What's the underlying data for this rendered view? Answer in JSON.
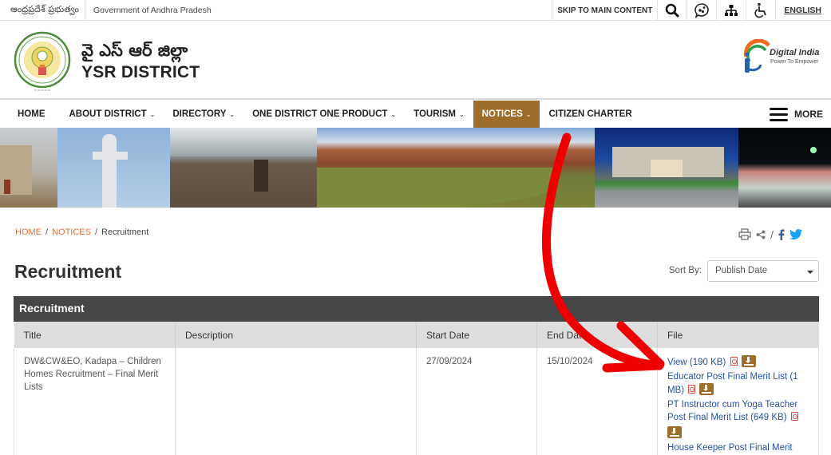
{
  "topbar": {
    "gov_telugu": "ఆంధ్రప్రదేశ్ ప్రభుత్వం",
    "gov_english": "Government of Andhra Pradesh",
    "skip_link": "SKIP TO MAIN CONTENT",
    "language": "ENGLISH",
    "icons": [
      "search-icon",
      "social-media-icon",
      "sitemap-icon",
      "accessibility-icon"
    ]
  },
  "header": {
    "title_telugu": "వై ఎస్ ఆర్ జిల్లా",
    "title_english": "YSR DISTRICT",
    "partner_logo": "Digital India",
    "partner_tagline": "Power To Empower"
  },
  "nav": {
    "items": [
      {
        "label": "HOME",
        "dropdown": false,
        "active": false
      },
      {
        "label": "ABOUT DISTRICT",
        "dropdown": true,
        "active": false
      },
      {
        "label": "DIRECTORY",
        "dropdown": true,
        "active": false
      },
      {
        "label": "ONE DISTRICT ONE PRODUCT",
        "dropdown": true,
        "active": false
      },
      {
        "label": "TOURISM",
        "dropdown": true,
        "active": false
      },
      {
        "label": "NOTICES",
        "dropdown": true,
        "active": true
      },
      {
        "label": "CITIZEN CHARTER",
        "dropdown": false,
        "active": false
      }
    ],
    "more_label": "MORE",
    "active_color": "#9e6d2b"
  },
  "breadcrumb": {
    "items": [
      "HOME",
      "NOTICES"
    ],
    "current": "Recruitment",
    "separator": "/",
    "share_separator": "/"
  },
  "page": {
    "title": "Recruitment",
    "sort_label": "Sort By:",
    "sort_value": "Publish Date"
  },
  "table": {
    "caption": "Recruitment",
    "columns": [
      "Title",
      "Description",
      "Start Date",
      "End Date",
      "File"
    ],
    "rows": [
      {
        "title": "DW&CW&EO, Kadapa – Children Homes Recruitment – Final Merit Lists",
        "description": "",
        "start_date": "27/09/2024",
        "end_date": "15/10/2024",
        "files": [
          {
            "label": "View (190 KB)"
          },
          {
            "label": "Educator Post Final Merit List (1 MB)"
          },
          {
            "label": "PT Instructor cum Yoga Teacher Post Final Merit List (649 KB)"
          },
          {
            "label": "House Keeper Post Final Merit"
          }
        ]
      }
    ]
  },
  "annotation": {
    "type": "red-curved-arrow",
    "color": "#ee0000",
    "points_to": "View (190 KB)"
  }
}
